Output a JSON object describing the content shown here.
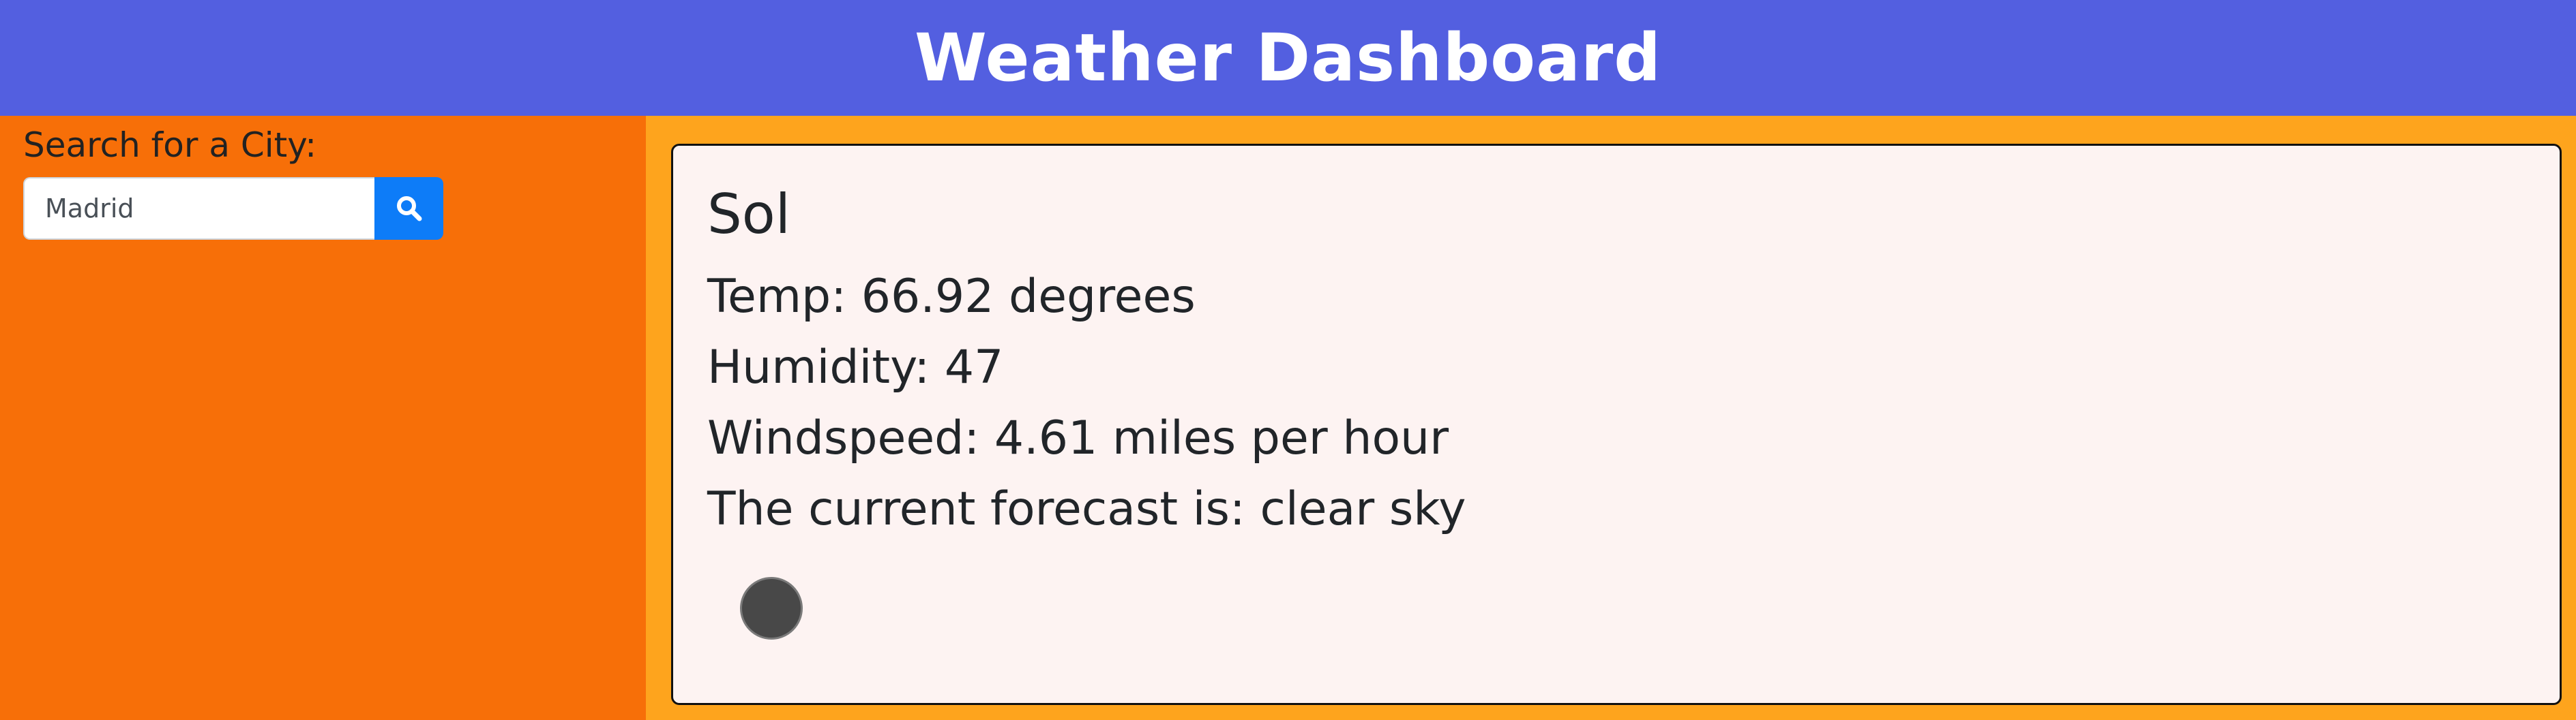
{
  "header": {
    "title": "Weather Dashboard"
  },
  "sidebar": {
    "search_label": "Search for a City:",
    "search_value": "Madrid",
    "search_button_icon": "search-icon"
  },
  "current": {
    "city": "Sol",
    "temp": "Temp: 66.92 degrees",
    "humidity": "Humidity: 47",
    "windspeed": "Windspeed: 4.61 miles per hour",
    "forecast": "The current forecast is: clear sky",
    "weather_icon": "clear-sky-icon"
  },
  "colors": {
    "header_bg": "#535fe0",
    "sidebar_bg": "#f76f08",
    "main_bg": "#fea41d",
    "card_bg": "#fdf3f2",
    "button_bg": "#0d7cf8"
  }
}
